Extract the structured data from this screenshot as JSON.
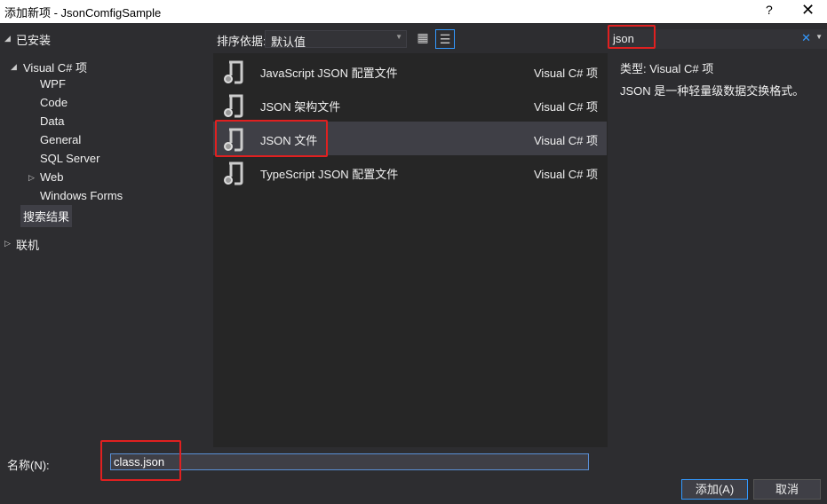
{
  "window": {
    "title": "添加新项 - JsonComfigSample",
    "help": "?",
    "close": "✕"
  },
  "sidebar": {
    "installed": "已安装",
    "visual_csharp": "Visual C# 项",
    "items": [
      "WPF",
      "Code",
      "Data",
      "General",
      "SQL Server",
      "Web",
      "Windows Forms",
      "搜索结果"
    ],
    "online": "联机"
  },
  "toolbar": {
    "sort_label": "排序依据:",
    "sort_value": "默认值"
  },
  "search": {
    "value": "json",
    "clear": "✕"
  },
  "templates": [
    {
      "name": "JavaScript JSON 配置文件",
      "type": "Visual C# 项"
    },
    {
      "name": "JSON 架构文件",
      "type": "Visual C# 项"
    },
    {
      "name": "JSON 文件",
      "type": "Visual C# 项",
      "selected": true
    },
    {
      "name": "TypeScript JSON 配置文件",
      "type": "Visual C# 项"
    }
  ],
  "details": {
    "type_line": "类型:  Visual C# 项",
    "description": "JSON 是一种轻量级数据交换格式。"
  },
  "footer": {
    "name_label": "名称(N):",
    "name_value": "class.json",
    "add": "添加(A)",
    "cancel": "取消"
  },
  "colors": {
    "accent": "#3399ff",
    "highlight": "#e02020"
  }
}
